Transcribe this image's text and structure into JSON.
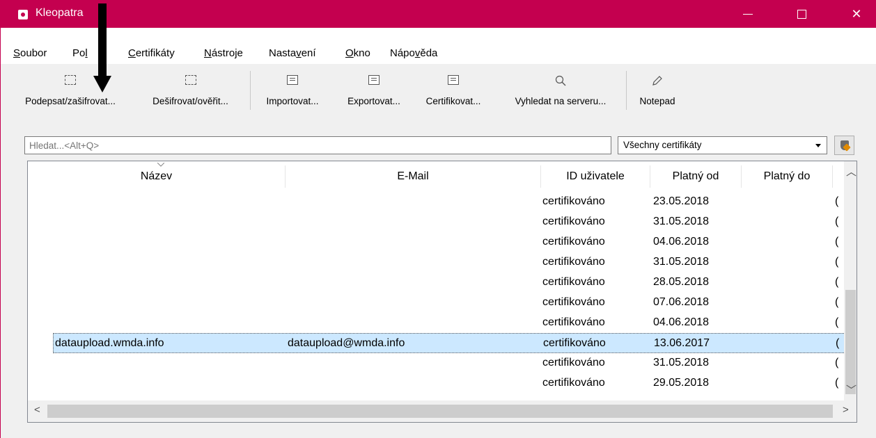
{
  "window": {
    "title": "Kleopatra"
  },
  "menu": [
    {
      "pre": "",
      "u": "S",
      "post": "oubor"
    },
    {
      "pre": "Po",
      "u": "l",
      "post": ""
    },
    {
      "pre": "",
      "u": "C",
      "post": "ertifikáty"
    },
    {
      "pre": "",
      "u": "N",
      "post": "ástroje"
    },
    {
      "pre": "Nasta",
      "u": "v",
      "post": "ení"
    },
    {
      "pre": "",
      "u": "O",
      "post": "kno"
    },
    {
      "pre": "Nápo",
      "u": "v",
      "post": "ěda"
    }
  ],
  "toolbar": [
    {
      "label": "Podepsat/zašifrovat...",
      "icon": "sign-encrypt-icon"
    },
    {
      "label": "Dešifrovat/ověřit...",
      "icon": "decrypt-verify-icon"
    },
    {
      "label": "Importovat...",
      "icon": "import-certificate-icon"
    },
    {
      "label": "Exportovat...",
      "icon": "export-certificate-icon"
    },
    {
      "label": "Certifikovat...",
      "icon": "certify-icon"
    },
    {
      "label": "Vyhledat na serveru...",
      "icon": "search-icon"
    },
    {
      "label": "Notepad",
      "icon": "pencil-icon"
    }
  ],
  "search": {
    "placeholder": "Hledat...<Alt+Q>"
  },
  "filter": {
    "selected": "Všechny certifikáty"
  },
  "table": {
    "columns": [
      "Název",
      "E-Mail",
      "ID uživatele",
      "Platný od",
      "Platný do"
    ],
    "rows": [
      {
        "name": "",
        "email": "",
        "uid": "certifikováno",
        "from": "23.05.2018",
        "to": "",
        "extra": "("
      },
      {
        "name": "",
        "email": "",
        "uid": "certifikováno",
        "from": "31.05.2018",
        "to": "",
        "extra": "("
      },
      {
        "name": "",
        "email": "",
        "uid": "certifikováno",
        "from": "04.06.2018",
        "to": "",
        "extra": "("
      },
      {
        "name": "",
        "email": "",
        "uid": "certifikováno",
        "from": "31.05.2018",
        "to": "",
        "extra": "("
      },
      {
        "name": "",
        "email": "",
        "uid": "certifikováno",
        "from": "28.05.2018",
        "to": "",
        "extra": "("
      },
      {
        "name": "",
        "email": "",
        "uid": "certifikováno",
        "from": "07.06.2018",
        "to": "",
        "extra": "("
      },
      {
        "name": "",
        "email": "",
        "uid": "certifikováno",
        "from": "04.06.2018",
        "to": "",
        "extra": "("
      },
      {
        "name": "dataupload.wmda.info",
        "email": "dataupload@wmda.info",
        "uid": "certifikováno",
        "from": "13.06.2017",
        "to": "",
        "extra": "(",
        "selected": true
      },
      {
        "name": "",
        "email": "",
        "uid": "certifikováno",
        "from": "31.05.2018",
        "to": "",
        "extra": "("
      },
      {
        "name": "",
        "email": "",
        "uid": "certifikováno",
        "from": "29.05.2018",
        "to": "",
        "extra": "("
      }
    ]
  }
}
